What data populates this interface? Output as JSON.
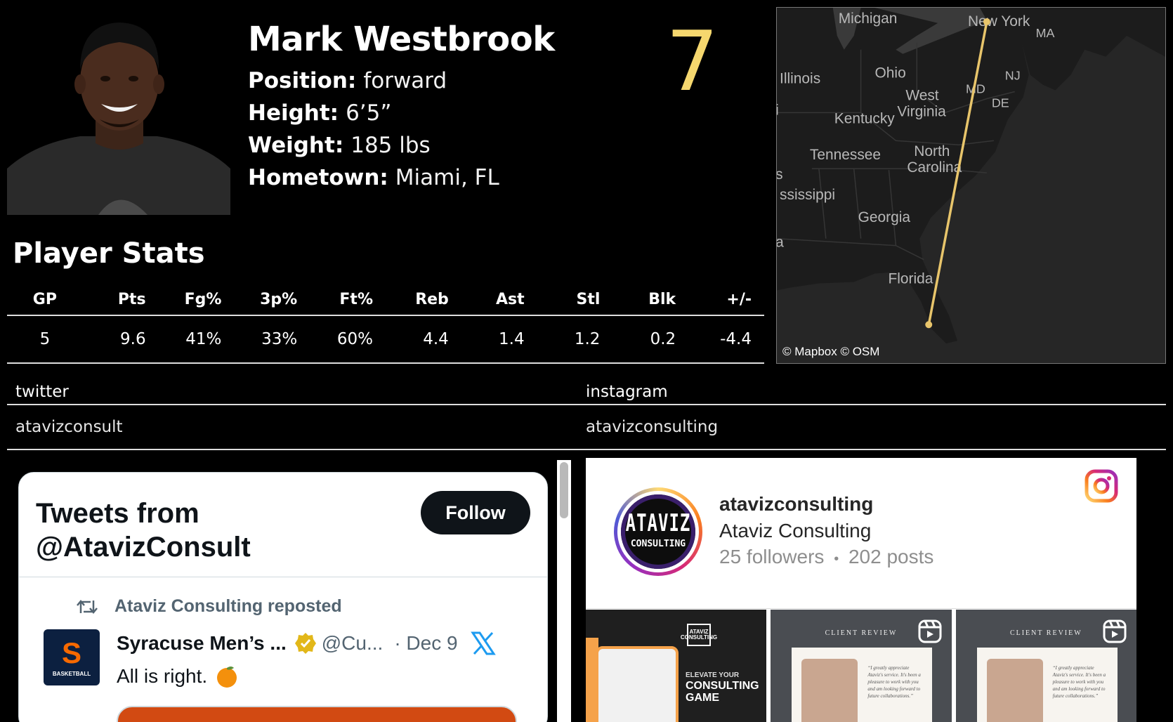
{
  "player": {
    "name": "Mark Westbrook",
    "jersey_number": "7",
    "position_label": "Position:",
    "position": "forward",
    "height_label": "Height:",
    "height": "6’5”",
    "weight_label": "Weight:",
    "weight": "185 lbs",
    "hometown_label": "Hometown:",
    "hometown": "Miami, FL"
  },
  "map": {
    "attribution": "© Mapbox  © OSM",
    "labels": {
      "michigan": "Michigan",
      "new_york": "New York",
      "ma": "MA",
      "illinois": "Illinois",
      "ohio": "Ohio",
      "nj": "NJ",
      "md": "MD",
      "de": "DE",
      "west": "West",
      "virginia": "Virginia",
      "kentucky": "Kentucky",
      "tennessee": "Tennessee",
      "north": "North",
      "carolina": "Carolina",
      "mississippi": "ssissippi",
      "georgia": "Georgia",
      "florida": "Florida",
      "edge_s": "s",
      "edge_i": "i",
      "edge_a": "a"
    },
    "route_color": "#e8c56b"
  },
  "stats": {
    "title": "Player Stats",
    "headers": [
      "GP",
      "Pts",
      "Fg%",
      "3p%",
      "Ft%",
      "Reb",
      "Ast",
      "Stl",
      "Blk",
      "+/-"
    ],
    "values": [
      "5",
      "9.6",
      "41%",
      "33%",
      "60%",
      "4.4",
      "1.4",
      "1.2",
      "0.2",
      "-4.4"
    ]
  },
  "social": {
    "twitter_label": "twitter",
    "instagram_label": "instagram",
    "twitter_handle": "atavizconsult",
    "instagram_handle": "atavizconsulting"
  },
  "twitter_widget": {
    "title_line1": "Tweets from",
    "title_line2": "@AtavizConsult",
    "follow_label": "Follow",
    "repost_text": "Ataviz Consulting reposted",
    "tweet_author": "Syracuse Men’s ...",
    "tweet_handle": "@Cu...",
    "tweet_date": "· Dec 9",
    "tweet_text": "All is right.",
    "avatar_letter": "S",
    "avatar_caption": "BASKETBALL"
  },
  "instagram_widget": {
    "username": "atavizconsulting",
    "full_name": "Ataviz Consulting",
    "followers": "25 followers",
    "separator": "•",
    "posts": "202 posts",
    "avatar_line1": "ATAVIZ",
    "avatar_line2": "CONSULTING",
    "tile1_small": "ELEVATE YOUR",
    "tile1_big1": "CONSULTING",
    "tile1_big2": "GAME",
    "tile1_logo": "ATAVIZ CONSULTING",
    "tile_review_title": "CLIENT REVIEW",
    "tile_review_quote": "“I greatly appreciate Ataviz's service. It's been a pleasure to work with you and am looking forward to future collaborations.”"
  }
}
